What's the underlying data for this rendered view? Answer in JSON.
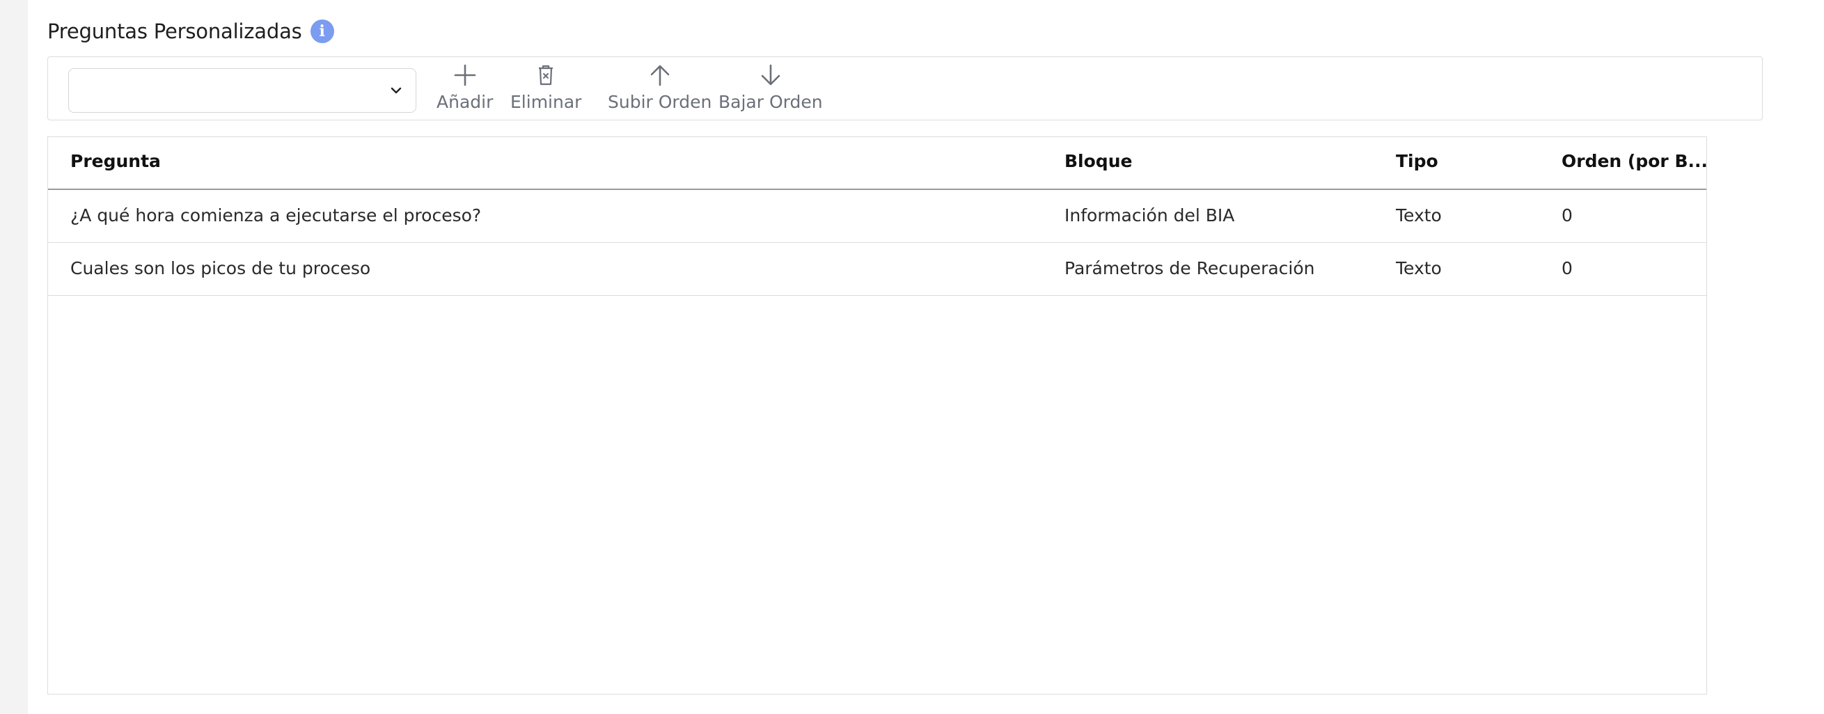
{
  "section": {
    "title": "Preguntas Personalizadas",
    "info_icon": "info-icon"
  },
  "toolbar": {
    "select_value": "",
    "buttons": [
      {
        "label": "Añadir",
        "icon": "plus-icon"
      },
      {
        "label": "Eliminar",
        "icon": "trash-icon"
      },
      {
        "label": "Subir Orden",
        "icon": "arrow-up-icon"
      },
      {
        "label": "Bajar Orden",
        "icon": "arrow-down-icon"
      }
    ]
  },
  "table": {
    "columns": [
      "Pregunta",
      "Bloque",
      "Tipo",
      "Orden (por B..."
    ],
    "rows": [
      [
        "¿A qué hora comienza a ejecutarse el proceso?",
        "Información del BIA",
        "Texto",
        "0"
      ],
      [
        "Cuales son los picos de tu proceso",
        "Parámetros de Recuperación",
        "Texto",
        "0"
      ]
    ]
  },
  "colors": {
    "info_icon": "#7b9cf0",
    "toolbar_text": "#6b6f78",
    "border": "#dcdcdc"
  }
}
